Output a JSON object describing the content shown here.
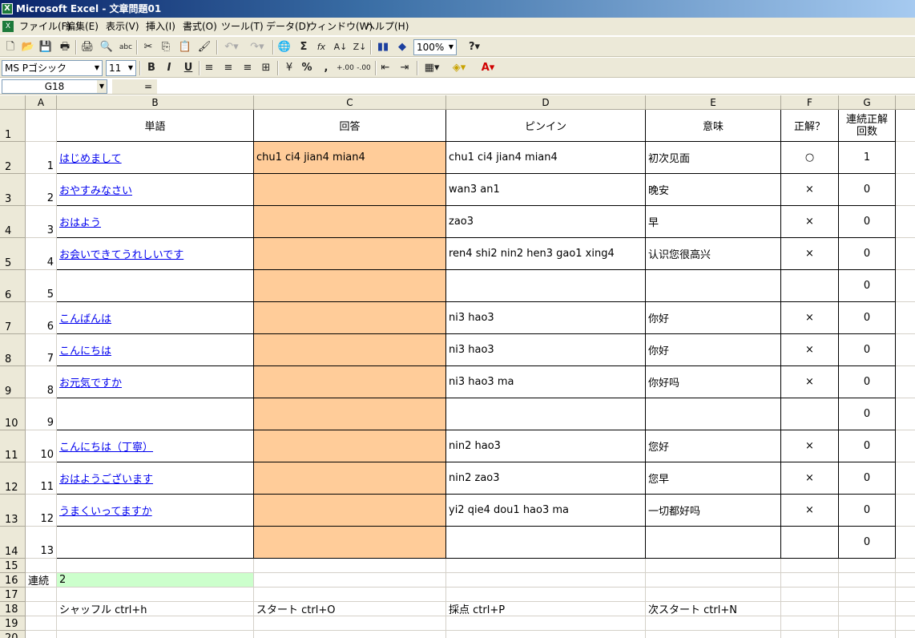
{
  "app": {
    "title": "Microsoft Excel - 文章問題01",
    "menu": [
      "ファイル(F)",
      "編集(E)",
      "表示(V)",
      "挿入(I)",
      "書式(O)",
      "ツール(T)",
      "データ(D)",
      "ウィンドウ(W)",
      "ヘルプ(H)"
    ]
  },
  "toolbar": {
    "zoom": "100%",
    "font_name": "MS Pゴシック",
    "font_size": "11",
    "bold": "B",
    "italic": "I",
    "underline": "U",
    "percent": "%",
    "comma": ",",
    "sum": "Σ",
    "fx": "fx",
    "help": "?"
  },
  "formula_bar": {
    "cell_ref": "G18",
    "equals": "=",
    "value": ""
  },
  "columns": [
    "A",
    "B",
    "C",
    "D",
    "E",
    "F",
    "G"
  ],
  "rows": [
    "1",
    "2",
    "3",
    "4",
    "5",
    "6",
    "7",
    "8",
    "9",
    "10",
    "11",
    "12",
    "13",
    "14",
    "15",
    "16",
    "17",
    "18",
    "19",
    "20"
  ],
  "table": {
    "headers": {
      "b": "単語",
      "c": "回答",
      "d": "ピンイン",
      "e": "意味",
      "f": "正解？",
      "g": "連続正解回数"
    },
    "records": [
      {
        "num": "1",
        "word": "はじめまして",
        "answer": "chu1  ci4  jian4  mian4",
        "pinyin": "chu1  ci4  jian4  mian4",
        "meaning": "初次见面",
        "correct": "○",
        "streak": "1"
      },
      {
        "num": "2",
        "word": "おやすみなさい",
        "answer": "",
        "pinyin": "wan3 an1",
        "meaning": "晚安",
        "correct": "×",
        "streak": "0"
      },
      {
        "num": "3",
        "word": "おはよう",
        "answer": "",
        "pinyin": "zao3",
        "meaning": "早",
        "correct": "×",
        "streak": "0"
      },
      {
        "num": "4",
        "word": "お会いできてうれしいです",
        "answer": "",
        "pinyin": "ren4 shi2 nin2 hen3 gao1 xing4",
        "meaning": "认识您很高兴",
        "correct": "×",
        "streak": "0"
      },
      {
        "num": "5",
        "word": "",
        "answer": "",
        "pinyin": "",
        "meaning": "",
        "correct": "",
        "streak": "0"
      },
      {
        "num": "6",
        "word": "こんばんは",
        "answer": "",
        "pinyin": "ni3  hao3",
        "meaning": "你好",
        "correct": "×",
        "streak": "0"
      },
      {
        "num": "7",
        "word": "こんにちは",
        "answer": "",
        "pinyin": "ni3  hao3",
        "meaning": "你好",
        "correct": "×",
        "streak": "0"
      },
      {
        "num": "8",
        "word": "お元気ですか",
        "answer": "",
        "pinyin": "ni3  hao3  ma",
        "meaning": "你好吗",
        "correct": "×",
        "streak": "0"
      },
      {
        "num": "9",
        "word": "",
        "answer": "",
        "pinyin": "",
        "meaning": "",
        "correct": "",
        "streak": "0"
      },
      {
        "num": "10",
        "word": "こんにちは（丁寧）",
        "answer": "",
        "pinyin": "nin2  hao3",
        "meaning": "您好",
        "correct": "×",
        "streak": "0"
      },
      {
        "num": "11",
        "word": "おはようございます",
        "answer": "",
        "pinyin": "nin2  zao3",
        "meaning": "您早",
        "correct": "×",
        "streak": "0"
      },
      {
        "num": "12",
        "word": "うまくいってますか",
        "answer": "",
        "pinyin": "yi2  qie4  dou1  hao3  ma",
        "meaning": "一切都好吗",
        "correct": "×",
        "streak": "0"
      },
      {
        "num": "13",
        "word": "",
        "answer": "",
        "pinyin": "",
        "meaning": "",
        "correct": "",
        "streak": "0"
      }
    ]
  },
  "footer": {
    "streak_label": "連続",
    "streak_value": "2",
    "shortcut_shuffle": "シャッフル   ctrl+h",
    "shortcut_start": "スタート   ctrl+O",
    "shortcut_grade": "採点   ctrl+P",
    "shortcut_next": "次スタート   ctrl+N"
  }
}
